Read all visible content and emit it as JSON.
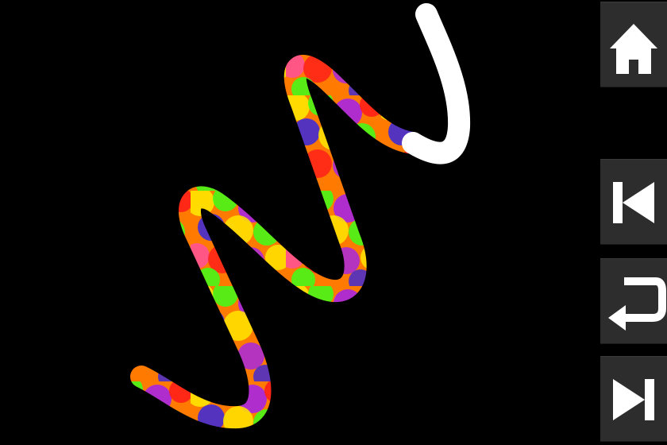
{
  "sidebar": {
    "buttons": [
      {
        "id": "home",
        "icon": "home-icon"
      },
      {
        "id": "previous",
        "icon": "skip-previous-icon"
      },
      {
        "id": "undo",
        "icon": "return-arrow-icon"
      },
      {
        "id": "next",
        "icon": "skip-next-icon"
      }
    ]
  },
  "colors": {
    "background": "#000000",
    "button_bg": "#2d2d2d",
    "icon": "#ffffff",
    "trace_guide": "#ffffff",
    "bubble_palette": [
      "#ff1a1a",
      "#ff7a00",
      "#ffe600",
      "#3cff1a",
      "#1a1aff",
      "#9a1aff",
      "#ff4da6"
    ]
  },
  "game": {
    "stroke_style": "rainbow-bubbles",
    "remaining_path": "white"
  }
}
